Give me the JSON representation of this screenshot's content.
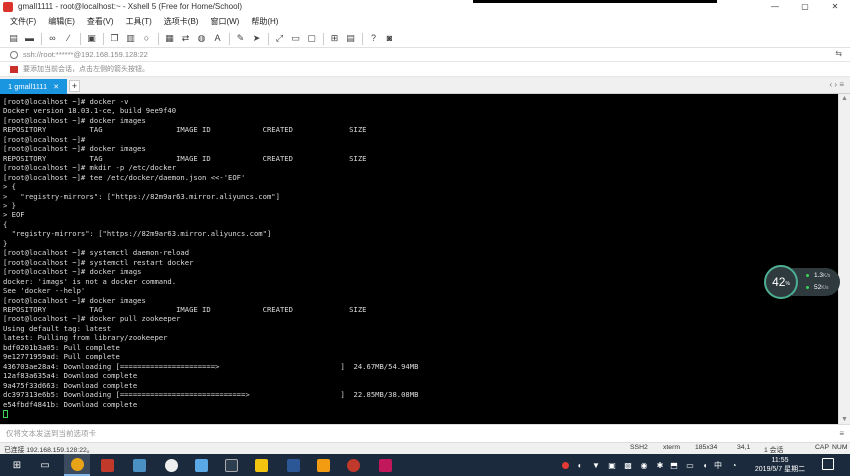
{
  "window": {
    "title": "gmall1111 - root@localhost:~ - Xshell 5 (Free for Home/School)",
    "controls": {
      "minimize": "—",
      "maximize": "▢",
      "close": "✕"
    }
  },
  "menu": [
    "文件(F)",
    "编辑(E)",
    "查看(V)",
    "工具(T)",
    "选项卡(B)",
    "窗口(W)",
    "帮助(H)"
  ],
  "toolbar": {
    "icons": [
      "new-session-icon",
      "open-folder-icon",
      "link-icon",
      "disconnect-icon",
      "properties-icon",
      "copy-icon",
      "paste-icon",
      "find-icon",
      "print-icon",
      "transfer-icon",
      "globe-icon",
      "font-icon",
      "script-icon",
      "send-icon",
      "expand-icon",
      "keyboard-icon",
      "lock-icon",
      "compose-icon",
      "layout-icon",
      "help-icon",
      "message-icon"
    ]
  },
  "address": {
    "text": "ssh://root:******@192.168.159.128:22"
  },
  "hint": {
    "text": "要添加当前会话，点击左侧的箭头按钮。"
  },
  "tabs": [
    {
      "label": "1 gmall1111"
    }
  ],
  "terminal": {
    "lines": [
      "[root@localhost ~]# docker -v",
      "Docker version 18.03.1-ce, build 9ee9f40",
      "[root@localhost ~]# docker images",
      "REPOSITORY          TAG                 IMAGE ID            CREATED             SIZE",
      "[root@localhost ~]#",
      "[root@localhost ~]# docker images",
      "REPOSITORY          TAG                 IMAGE ID            CREATED             SIZE",
      "[root@localhost ~]# mkdir -p /etc/docker",
      "[root@localhost ~]# tee /etc/docker/daemon.json <<-'EOF'",
      "> {",
      ">   \"registry-mirrors\": [\"https://82m9ar63.mirror.aliyuncs.com\"]",
      "> }",
      "> EOF",
      "{",
      "  \"registry-mirrors\": [\"https://82m9ar63.mirror.aliyuncs.com\"]",
      "}",
      "[root@localhost ~]# systemctl daemon-reload",
      "[root@localhost ~]# systemctl restart docker",
      "[root@localhost ~]# docker imags",
      "docker: 'imags' is not a docker command.",
      "See 'docker --help'",
      "[root@localhost ~]# docker images",
      "REPOSITORY          TAG                 IMAGE ID            CREATED             SIZE",
      "[root@localhost ~]# docker pull zookeeper",
      "Using default tag: latest",
      "latest: Pulling from library/zookeeper",
      "bdf0201b3a05: Pull complete",
      "9e12771959ad: Pull complete",
      "436703ae28a4: Downloading [======================>                            ]  24.67MB/54.94MB",
      "12af83a635a4: Download complete",
      "9a475f33d663: Download complete",
      "dc397313e6b5: Downloading [=============================>                     ]  22.85MB/38.08MB",
      "e54fbdf4841b: Download complete"
    ]
  },
  "network_widget": {
    "percent": "42",
    "percent_unit": "%",
    "upload": "1.3",
    "upload_unit": "K/s",
    "download": "52",
    "download_unit": "K/s",
    "upload_color": "#39d353",
    "download_color": "#39d353"
  },
  "sendbar": {
    "placeholder": "仅将文本发送到当前选项卡"
  },
  "status": {
    "connected": "已连接 192.168.159.128:22。",
    "protocol": "SSH2",
    "term": "xterm",
    "size": "185x34",
    "cursor": "34,1",
    "sessions": "1 会话",
    "caps": "CAP",
    "num": "NUM"
  },
  "taskbar": {
    "time": "11:55",
    "date": "2019/5/7 星期二",
    "ime": "中",
    "apps": [
      "windows-icon",
      "task-view-icon",
      "chrome-icon",
      "xshell-icon",
      "app-icon",
      "wechat-icon",
      "feather-icon",
      "terminal-icon",
      "folder-icon",
      "word-icon",
      "app2-icon",
      "xshell2-icon",
      "idea-icon"
    ]
  }
}
